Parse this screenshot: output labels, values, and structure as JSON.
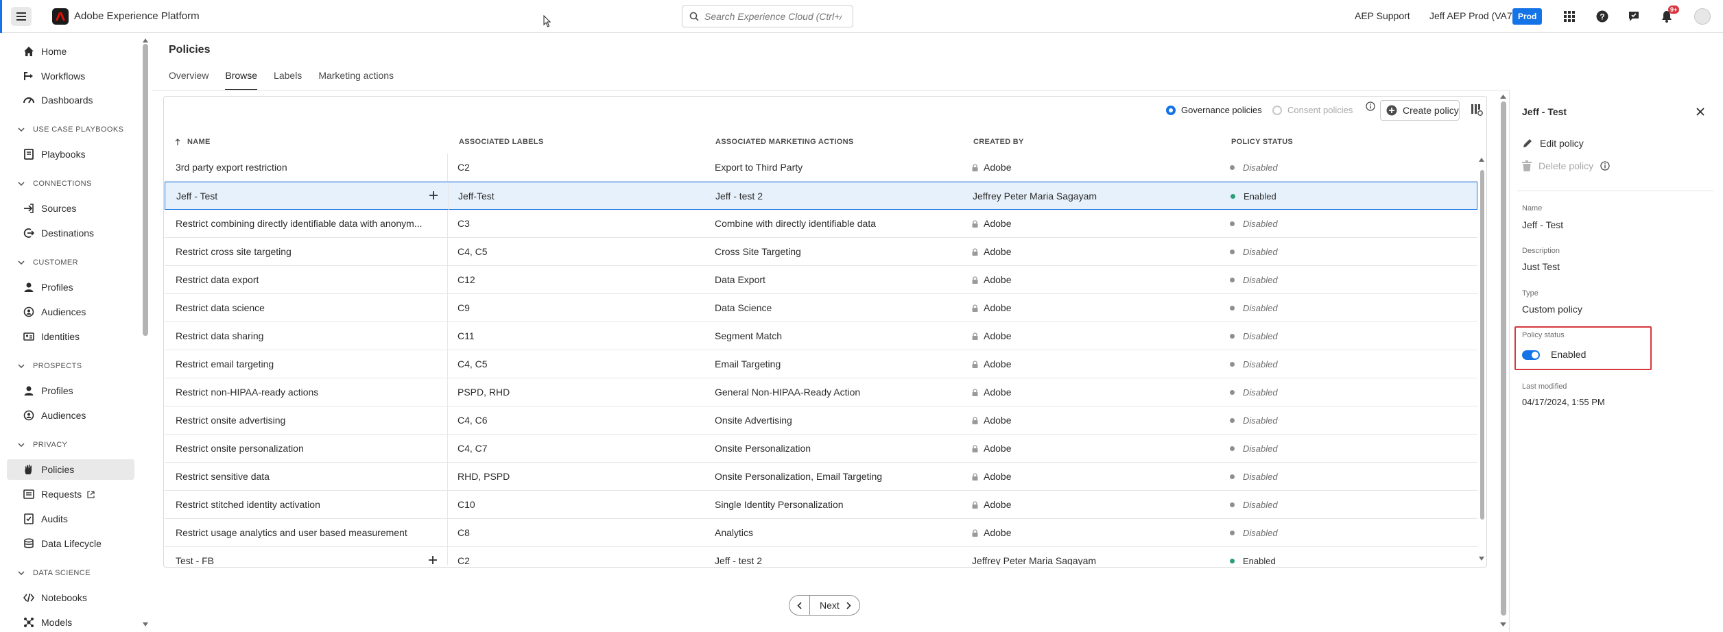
{
  "app": {
    "title": "Adobe Experience Platform",
    "search_placeholder": "Search Experience Cloud (Ctrl+/)",
    "support_label": "AEP Support",
    "org_label": "Jeff AEP Prod (VA7)",
    "env_badge": "Prod",
    "notification_count": "9+",
    "accent_color": "#1473e6"
  },
  "sidebar": {
    "home": "Home",
    "workflows": "Workflows",
    "dashboards": "Dashboards",
    "section_playbooks": "USE CASE PLAYBOOKS",
    "playbooks": "Playbooks",
    "section_connections": "CONNECTIONS",
    "sources": "Sources",
    "destinations": "Destinations",
    "section_customer": "CUSTOMER",
    "profiles": "Profiles",
    "audiences": "Audiences",
    "identities": "Identities",
    "section_prospects": "PROSPECTS",
    "prospect_profiles": "Profiles",
    "prospect_audiences": "Audiences",
    "section_privacy": "PRIVACY",
    "policies": "Policies",
    "requests": "Requests",
    "audits": "Audits",
    "data_lifecycle": "Data Lifecycle",
    "section_data_science": "DATA SCIENCE",
    "notebooks": "Notebooks",
    "models": "Models"
  },
  "page": {
    "title": "Policies",
    "tabs": [
      "Overview",
      "Browse",
      "Labels",
      "Marketing actions"
    ],
    "active_tab": "Browse"
  },
  "toolbar": {
    "governance_label": "Governance policies",
    "consent_label": "Consent policies",
    "create_label": "Create policy"
  },
  "table": {
    "columns": [
      "NAME",
      "ASSOCIATED LABELS",
      "ASSOCIATED MARKETING ACTIONS",
      "CREATED BY",
      "POLICY STATUS"
    ],
    "rows": [
      {
        "name": "3rd party export restriction",
        "labels": "C2",
        "actions": "Export to Third Party",
        "created_by": "Adobe",
        "locked": true,
        "status": "Disabled"
      },
      {
        "name": "Jeff - Test",
        "labels": "Jeff-Test",
        "actions": "Jeff - test 2",
        "created_by": "Jeffrey Peter Maria Sagayam",
        "locked": false,
        "status": "Enabled",
        "selected": true,
        "expandable": true
      },
      {
        "name": "Restrict combining directly identifiable data with anonym...",
        "labels": "C3",
        "actions": "Combine with directly identifiable data",
        "created_by": "Adobe",
        "locked": true,
        "status": "Disabled"
      },
      {
        "name": "Restrict cross site targeting",
        "labels": "C4, C5",
        "actions": "Cross Site Targeting",
        "created_by": "Adobe",
        "locked": true,
        "status": "Disabled"
      },
      {
        "name": "Restrict data export",
        "labels": "C12",
        "actions": "Data Export",
        "created_by": "Adobe",
        "locked": true,
        "status": "Disabled"
      },
      {
        "name": "Restrict data science",
        "labels": "C9",
        "actions": "Data Science",
        "created_by": "Adobe",
        "locked": true,
        "status": "Disabled"
      },
      {
        "name": "Restrict data sharing",
        "labels": "C11",
        "actions": "Segment Match",
        "created_by": "Adobe",
        "locked": true,
        "status": "Disabled"
      },
      {
        "name": "Restrict email targeting",
        "labels": "C4, C5",
        "actions": "Email Targeting",
        "created_by": "Adobe",
        "locked": true,
        "status": "Disabled"
      },
      {
        "name": "Restrict non-HIPAA-ready actions",
        "labels": "PSPD, RHD",
        "actions": "General Non-HIPAA-Ready Action",
        "created_by": "Adobe",
        "locked": true,
        "status": "Disabled"
      },
      {
        "name": "Restrict onsite advertising",
        "labels": "C4, C6",
        "actions": "Onsite Advertising",
        "created_by": "Adobe",
        "locked": true,
        "status": "Disabled"
      },
      {
        "name": "Restrict onsite personalization",
        "labels": "C4, C7",
        "actions": "Onsite Personalization",
        "created_by": "Adobe",
        "locked": true,
        "status": "Disabled"
      },
      {
        "name": "Restrict sensitive data",
        "labels": "RHD, PSPD",
        "actions": "Onsite Personalization, Email Targeting",
        "created_by": "Adobe",
        "locked": true,
        "status": "Disabled"
      },
      {
        "name": "Restrict stitched identity activation",
        "labels": "C10",
        "actions": "Single Identity Personalization",
        "created_by": "Adobe",
        "locked": true,
        "status": "Disabled"
      },
      {
        "name": "Restrict usage analytics and user based measurement",
        "labels": "C8",
        "actions": "Analytics",
        "created_by": "Adobe",
        "locked": true,
        "status": "Disabled"
      },
      {
        "name": "Test - FB",
        "labels": "C2",
        "actions": "Jeff - test 2",
        "created_by": "Jeffrey Peter Maria Sagayam",
        "locked": false,
        "status": "Enabled",
        "expandable": true
      }
    ],
    "status_colors": {
      "Enabled": "#2d9d78",
      "Disabled": "#8e8e8e"
    }
  },
  "pagination": {
    "next_label": "Next"
  },
  "detail": {
    "title": "Jeff - Test",
    "edit_label": "Edit policy",
    "delete_label": "Delete policy",
    "name_label": "Name",
    "name_value": "Jeff - Test",
    "description_label": "Description",
    "description_value": "Just Test",
    "type_label": "Type",
    "type_value": "Custom policy",
    "status_label": "Policy status",
    "status_value": "Enabled",
    "modified_label": "Last modified",
    "modified_value": "04/17/2024, 1:55 PM"
  }
}
